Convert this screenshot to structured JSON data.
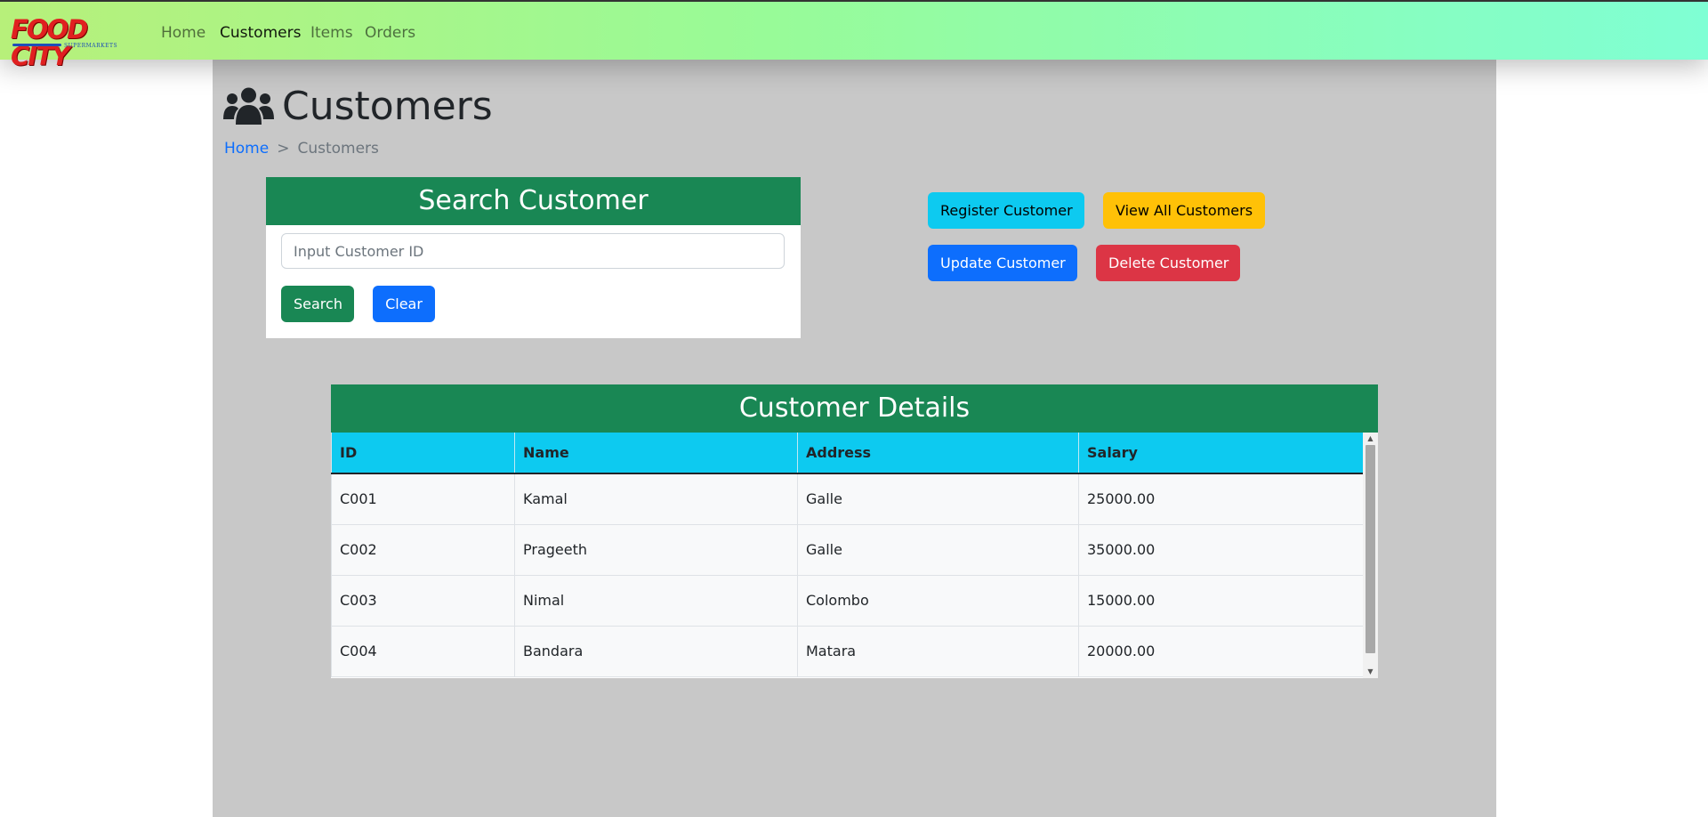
{
  "brand": {
    "name": "FOOD CITY",
    "tagline": "SUPERMARKETS"
  },
  "nav": {
    "items": [
      {
        "label": "Home"
      },
      {
        "label": "Customers"
      },
      {
        "label": "Items"
      },
      {
        "label": "Orders"
      }
    ],
    "active": "Customers"
  },
  "page": {
    "title": "Customers",
    "icon": "users-icon"
  },
  "breadcrumb": {
    "home": "Home",
    "separator": ">",
    "current": "Customers"
  },
  "search": {
    "heading": "Search Customer",
    "placeholder": "Input Customer ID",
    "value": "",
    "search_label": "Search",
    "clear_label": "Clear"
  },
  "actions": {
    "register_label": "Register Customer",
    "view_all_label": "View All Customers",
    "update_label": "Update Customer",
    "delete_label": "Delete Customer"
  },
  "table": {
    "heading": "Customer Details",
    "columns": [
      "ID",
      "Name",
      "Address",
      "Salary"
    ],
    "rows": [
      [
        "C001",
        "Kamal",
        "Galle",
        "25000.00"
      ],
      [
        "C002",
        "Prageeth",
        "Galle",
        "35000.00"
      ],
      [
        "C003",
        "Nimal",
        "Colombo",
        "15000.00"
      ],
      [
        "C004",
        "Bandara",
        "Matara",
        "20000.00"
      ]
    ]
  },
  "colors": {
    "panel_header": "#198754",
    "table_header": "#0dcaf0",
    "container_bg": "#c8c8c8",
    "primary": "#0d6efd",
    "warning": "#ffc107",
    "danger": "#dc3545"
  }
}
